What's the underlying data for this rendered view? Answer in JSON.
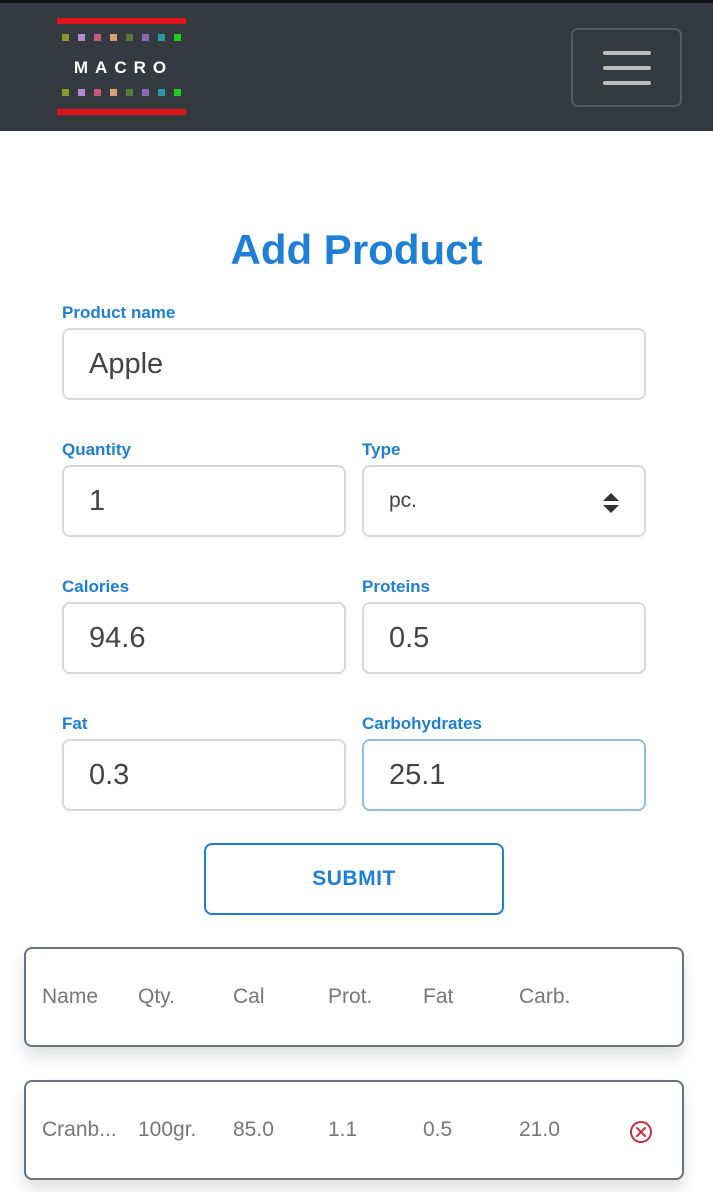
{
  "navbar": {
    "logo_text": "MACRO",
    "logo_dot_colors": [
      "#8a9a2a",
      "#b58ad4",
      "#c95a7a",
      "#d4a37a",
      "#5a7a3a",
      "#8a6ab4",
      "#2a9aa4",
      "#22cc22"
    ],
    "menu_icon": "hamburger-menu-icon"
  },
  "form": {
    "title": "Add Product",
    "product_name": {
      "label": "Product name",
      "value": "Apple"
    },
    "quantity": {
      "label": "Quantity",
      "value": "1"
    },
    "type": {
      "label": "Type",
      "value": "pc."
    },
    "calories": {
      "label": "Calories",
      "value": "94.6"
    },
    "proteins": {
      "label": "Proteins",
      "value": "0.5"
    },
    "fat": {
      "label": "Fat",
      "value": "0.3"
    },
    "carbohydrates": {
      "label": "Carbohydrates",
      "value": "25.1"
    },
    "submit_label": "SUBMIT"
  },
  "table": {
    "headers": [
      "Name",
      "Qty.",
      "Cal",
      "Prot.",
      "Fat",
      "Carb."
    ],
    "rows": [
      {
        "name": "Cranb...",
        "qty": "100gr.",
        "cal": "85.0",
        "prot": "1.1",
        "fat": "0.5",
        "carb": "21.0",
        "remove_icon": "remove-circle-x-icon"
      }
    ]
  },
  "colors": {
    "accent": "#1e7fd6",
    "navbar_bg": "#343a40",
    "logo_red": "#e3121b",
    "remove_red": "#c9303e"
  }
}
